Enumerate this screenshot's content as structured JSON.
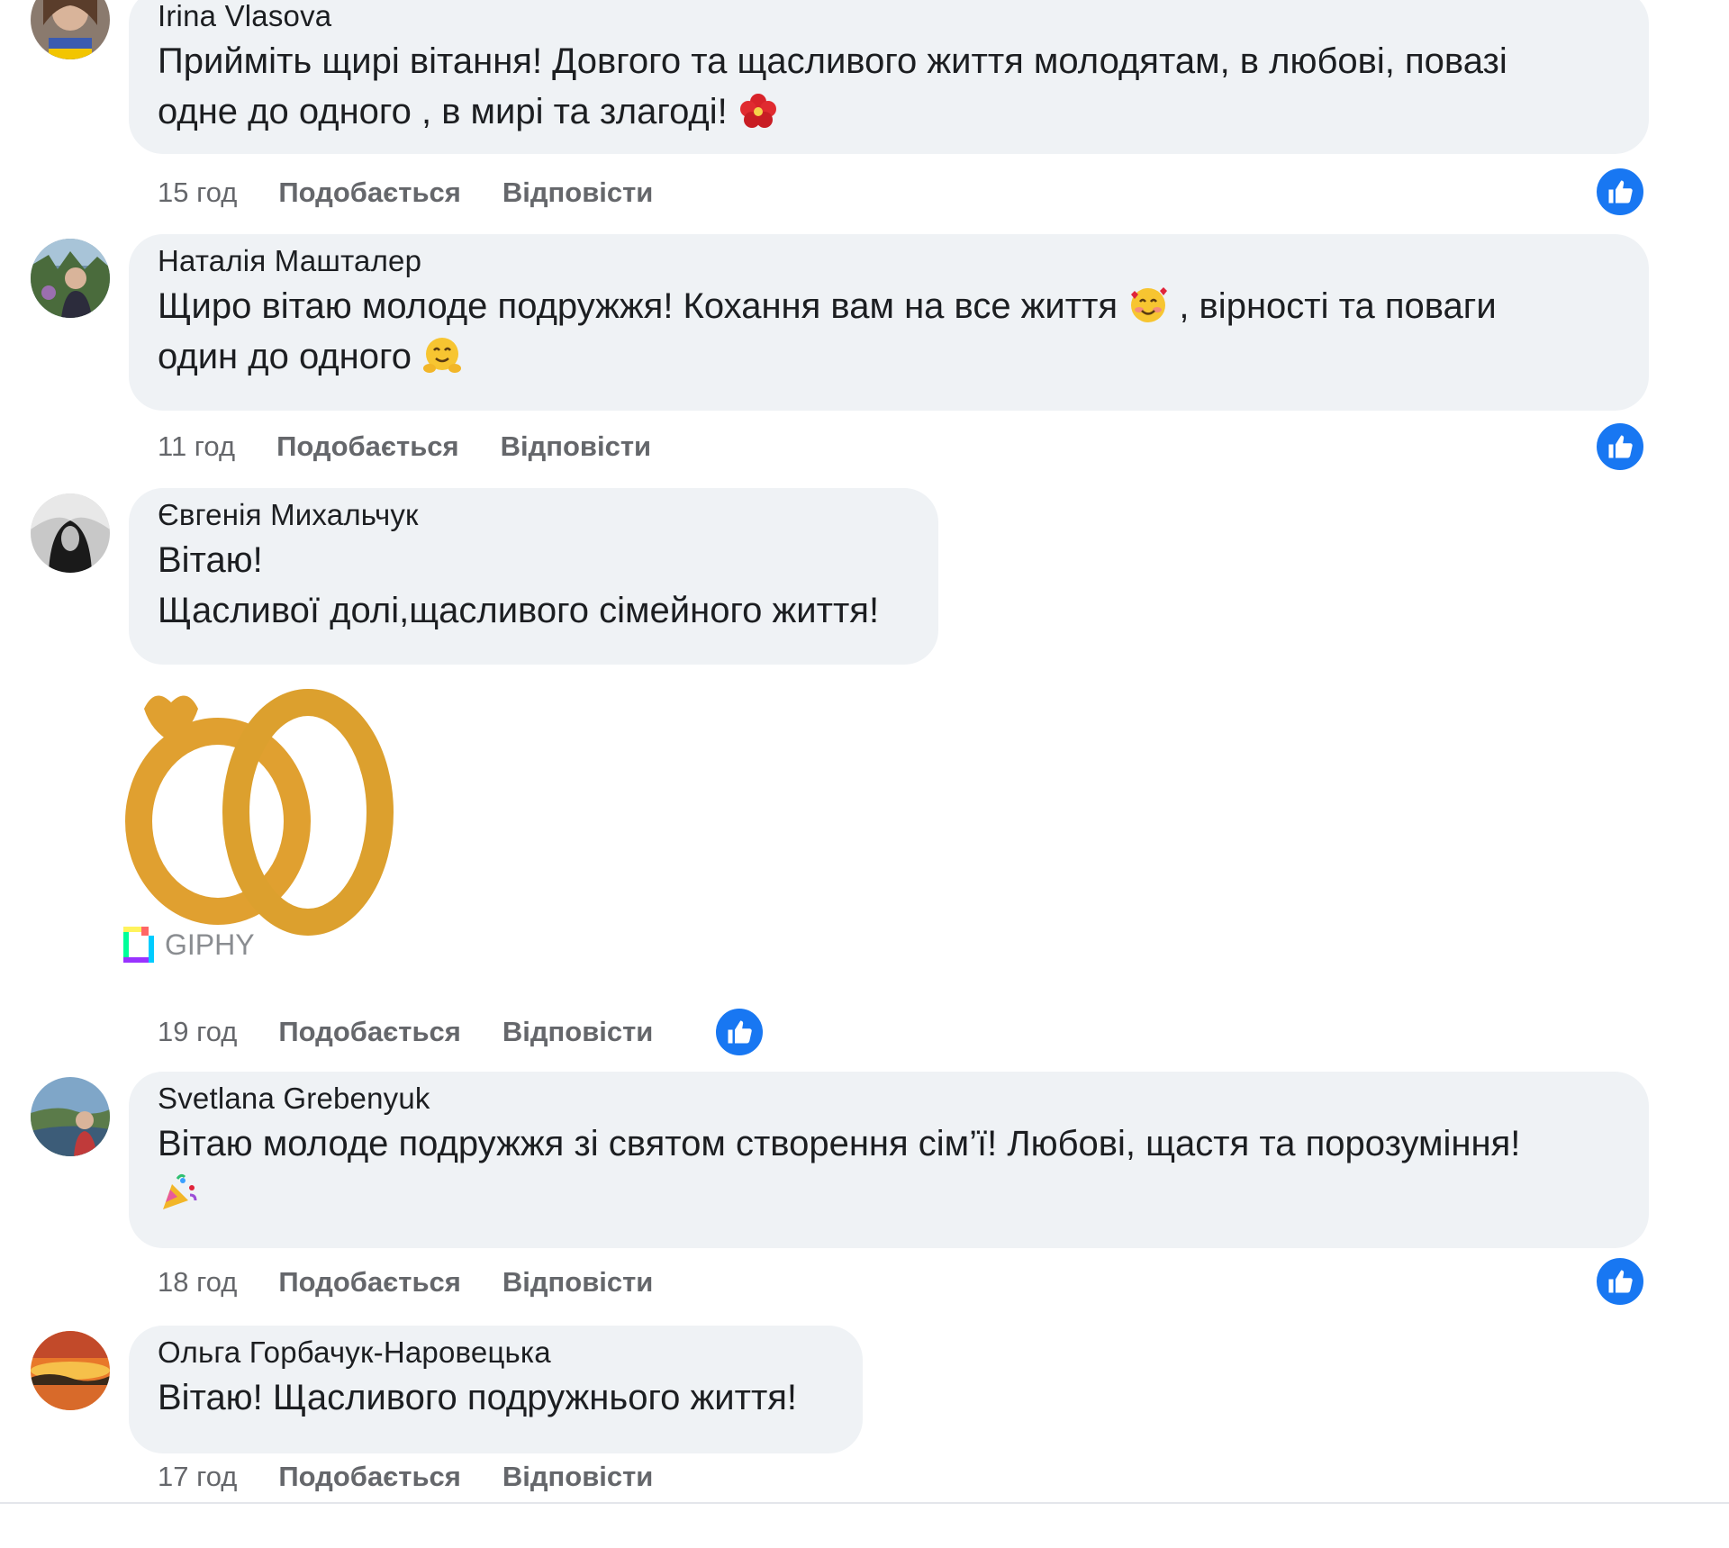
{
  "actions": {
    "like_label": "Подобається",
    "reply_label": "Відповісти"
  },
  "comments": [
    {
      "author": "Irina Vlasova",
      "lines": [
        "Прийміть щирі вітання! Довгого та щасливого життя молодятам, в любові, повазі",
        "одне до одного , в мирі та злагоді!"
      ],
      "emoji": "hibiscus-emoji",
      "time": "15 год",
      "liked": true
    },
    {
      "author": "Наталія Машталер",
      "lines": [
        "Щиро вітаю молоде подружжя! Кохання вам на все життя",
        ", вірності та поваги",
        "один до одного"
      ],
      "emoji": [
        "smiling-face-with-hearts-emoji",
        "hugging-face-emoji"
      ],
      "time": "11 год",
      "liked": true
    },
    {
      "author": "Євгенія Михальчук",
      "lines": [
        "Вітаю!",
        "Щасливої долі,щасливого сімейного життя!"
      ],
      "gif_label": "GIPHY",
      "gif_icon": "wedding-rings-gif",
      "time": "19 год",
      "liked": true
    },
    {
      "author": "Svetlana Grebenyuk",
      "lines": [
        "Вітаю молоде подружжя зі святом створення сім’ї! Любові, щастя та порозуміння!"
      ],
      "emoji": "party-popper-emoji",
      "time": "18 год",
      "liked": true
    },
    {
      "author": "Ольга Горбачук-Наровецька",
      "lines": [
        "Вітаю! Щасливого подружнього життя!"
      ],
      "time": "17 год",
      "liked": false
    }
  ],
  "colors": {
    "bubble": "#eff2f5",
    "like_blue": "#1877f2",
    "meta_grey": "#65676b",
    "gold": "#e0a030"
  }
}
